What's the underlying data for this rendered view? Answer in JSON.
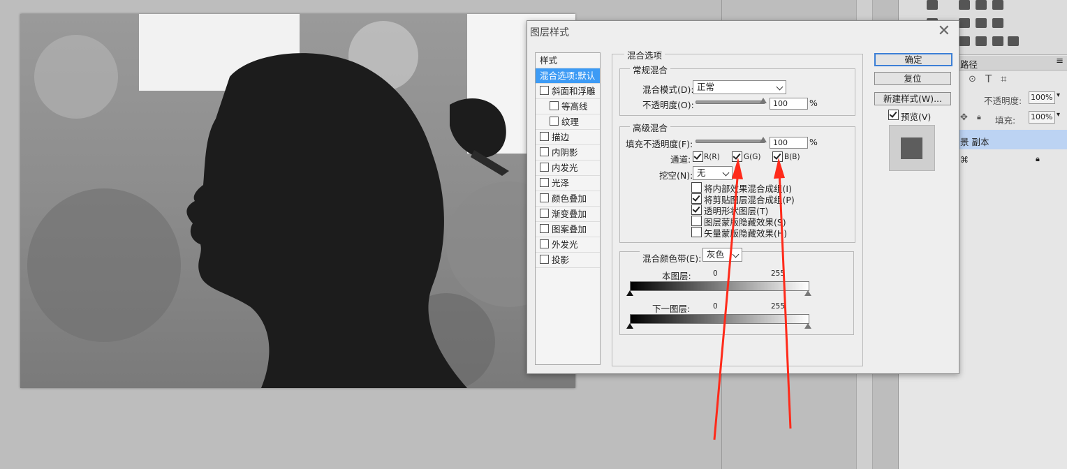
{
  "dialog": {
    "title": "图层样式",
    "close_glyph": "✕",
    "sidebar_header": "样式",
    "sidebar_items": [
      {
        "label": "混合选项:默认",
        "checkbox": false,
        "active": true,
        "indent": 0
      },
      {
        "label": "斜面和浮雕",
        "checkbox": true,
        "active": false,
        "indent": 0
      },
      {
        "label": "等高线",
        "checkbox": true,
        "active": false,
        "indent": 1
      },
      {
        "label": "纹理",
        "checkbox": true,
        "active": false,
        "indent": 1
      },
      {
        "label": "描边",
        "checkbox": true,
        "active": false,
        "indent": 0
      },
      {
        "label": "内阴影",
        "checkbox": true,
        "active": false,
        "indent": 0
      },
      {
        "label": "内发光",
        "checkbox": true,
        "active": false,
        "indent": 0
      },
      {
        "label": "光泽",
        "checkbox": true,
        "active": false,
        "indent": 0
      },
      {
        "label": "颜色叠加",
        "checkbox": true,
        "active": false,
        "indent": 0
      },
      {
        "label": "渐变叠加",
        "checkbox": true,
        "active": false,
        "indent": 0
      },
      {
        "label": "图案叠加",
        "checkbox": true,
        "active": false,
        "indent": 0
      },
      {
        "label": "外发光",
        "checkbox": true,
        "active": false,
        "indent": 0
      },
      {
        "label": "投影",
        "checkbox": true,
        "active": false,
        "indent": 0
      }
    ],
    "blend_options": {
      "group_title": "混合选项",
      "general": {
        "title": "常规混合",
        "mode_label": "混合模式(D):",
        "mode_value": "正常",
        "opacity_label": "不透明度(O):",
        "opacity_value": "100",
        "percent": "%"
      },
      "advanced": {
        "title": "高级混合",
        "fill_label": "填充不透明度(F):",
        "fill_value": "100",
        "percent": "%",
        "channels_label": "通道:",
        "channel_r": "R(R)",
        "channel_g": "G(G)",
        "channel_b": "B(B)",
        "knockout_label": "挖空(N):",
        "knockout_value": "无",
        "options": [
          {
            "label": "将内部效果混合成组(I)",
            "checked": false
          },
          {
            "label": "将剪贴图层混合成组(P)",
            "checked": true
          },
          {
            "label": "透明形状图层(T)",
            "checked": true
          },
          {
            "label": "图层蒙版隐藏效果(S)",
            "checked": false
          },
          {
            "label": "矢量蒙版隐藏效果(H)",
            "checked": false
          }
        ]
      },
      "blend_if": {
        "label": "混合颜色带(E):",
        "value": "灰色",
        "this_layer": "本图层:",
        "underlying": "下一图层:",
        "min": "0",
        "max": "255"
      }
    },
    "buttons": {
      "ok": "确定",
      "reset": "复位",
      "new_style": "新建样式(W)...",
      "preview": "预览(V)"
    }
  },
  "layers_panel": {
    "tab_paths": "路径",
    "opacity_label": "不透明度:",
    "opacity_value": "100%",
    "fill_label": "填充:",
    "fill_value": "100%",
    "layer_name": "景 副本"
  },
  "colors": {
    "accent": "#3d9bf5",
    "annotation_arrow": "#ff2a1a",
    "layer_selected": "#bcd3f3"
  }
}
